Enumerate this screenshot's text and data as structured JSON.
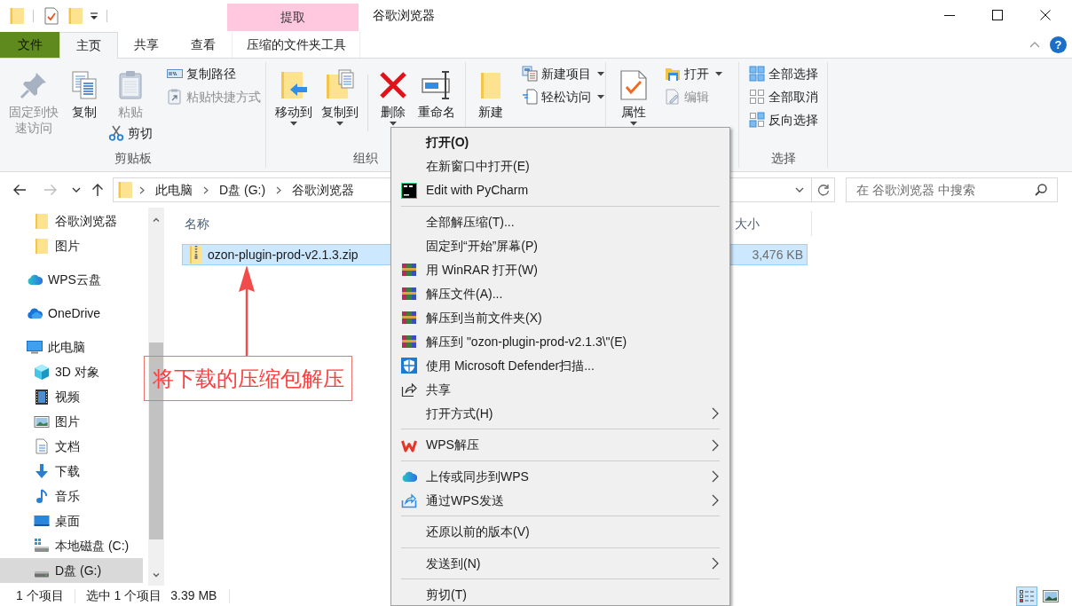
{
  "window": {
    "title": "谷歌浏览器",
    "contextual_tab_group": "提取"
  },
  "ribbon": {
    "tabs": [
      {
        "label": "文件",
        "kind": "file",
        "selected": false
      },
      {
        "label": "主页",
        "kind": "tab",
        "selected": true
      },
      {
        "label": "共享",
        "kind": "tab",
        "selected": false
      },
      {
        "label": "查看",
        "kind": "tab",
        "selected": false
      },
      {
        "label": "压缩的文件夹工具",
        "kind": "contextual",
        "selected": false
      }
    ],
    "help_button": "?",
    "groups": [
      {
        "label": "剪贴板",
        "columns": [
          {
            "buttons": [
              {
                "kind": "large",
                "label": "固定到快速访问",
                "disabled": true,
                "dropdown": false
              }
            ]
          },
          {
            "buttons": [
              {
                "kind": "large",
                "label": "复制",
                "disabled": false,
                "dropdown": false
              }
            ]
          },
          {
            "buttons": [
              {
                "kind": "large",
                "label": "粘贴",
                "disabled": true,
                "dropdown": false
              },
              {
                "kind": "small",
                "label": "剪切",
                "disabled": false,
                "dropdown": false
              }
            ]
          },
          {
            "buttons": [
              {
                "kind": "small",
                "label": "复制路径",
                "disabled": false,
                "dropdown": false
              },
              {
                "kind": "small",
                "label": "粘贴快捷方式",
                "disabled": true,
                "dropdown": false
              }
            ]
          }
        ]
      },
      {
        "label": "组织",
        "columns": [
          {
            "buttons": [
              {
                "kind": "large",
                "label": "移动到",
                "disabled": false,
                "dropdown": true
              }
            ]
          },
          {
            "buttons": [
              {
                "kind": "large",
                "label": "复制到",
                "disabled": false,
                "dropdown": true
              }
            ]
          },
          {
            "buttons": [
              {
                "kind": "large",
                "label": "删除",
                "disabled": false,
                "dropdown": true
              }
            ]
          },
          {
            "buttons": [
              {
                "kind": "large",
                "label": "重命名",
                "disabled": false,
                "dropdown": false
              }
            ]
          }
        ]
      },
      {
        "columns": [
          {
            "buttons": [
              {
                "kind": "large",
                "label": "新建",
                "disabled": false,
                "dropdown": false
              }
            ]
          },
          {
            "buttons": [
              {
                "kind": "small",
                "label": "新建项目",
                "disabled": false,
                "dropdown": true
              },
              {
                "kind": "small",
                "label": "轻松访问",
                "disabled": false,
                "dropdown": true
              }
            ]
          }
        ]
      },
      {
        "columns": [
          {
            "buttons": [
              {
                "kind": "large",
                "label": "属性",
                "disabled": false,
                "dropdown": true
              }
            ]
          },
          {
            "buttons": [
              {
                "kind": "small",
                "label": "打开",
                "disabled": false,
                "dropdown": true
              },
              {
                "kind": "small",
                "label": "编辑",
                "disabled": true,
                "dropdown": false
              }
            ]
          }
        ]
      },
      {
        "label": "选择",
        "columns": [
          {
            "buttons": [
              {
                "kind": "small",
                "label": "全部选择",
                "disabled": false,
                "dropdown": false
              },
              {
                "kind": "small",
                "label": "全部取消",
                "disabled": false,
                "dropdown": false
              },
              {
                "kind": "small",
                "label": "反向选择",
                "disabled": false,
                "dropdown": false
              }
            ]
          }
        ]
      }
    ]
  },
  "address_bar": {
    "nav_buttons": [
      {
        "kind": "back",
        "disabled": false
      },
      {
        "kind": "forward",
        "disabled": true
      },
      {
        "kind": "recent",
        "disabled": false
      },
      {
        "kind": "up",
        "disabled": false
      }
    ],
    "path": [
      "此电脑",
      "D盘 (G:)",
      "谷歌浏览器"
    ],
    "search": {
      "placeholder": "在 谷歌浏览器 中搜索"
    }
  },
  "nav_pane": {
    "tree": [
      {
        "children": [
          {
            "label": "谷歌浏览器",
            "selected": false
          },
          {
            "label": "图片",
            "selected": false
          }
        ]
      },
      {
        "label": "WPS云盘",
        "selected": false
      },
      {
        "label": "OneDrive",
        "selected": false
      },
      {
        "label": "此电脑",
        "selected": false,
        "children": [
          {
            "label": "3D 对象",
            "selected": false
          },
          {
            "label": "视频",
            "selected": false
          },
          {
            "label": "图片",
            "selected": false
          },
          {
            "label": "文档",
            "selected": false
          },
          {
            "label": "下载",
            "selected": false
          },
          {
            "label": "音乐",
            "selected": false
          },
          {
            "label": "桌面",
            "selected": false
          },
          {
            "label": "本地磁盘 (C:)",
            "selected": false
          },
          {
            "label": "D盘 (G:)",
            "selected": true
          }
        ]
      }
    ]
  },
  "file_list": {
    "columns": [
      {
        "label": "名称"
      },
      {
        "label": "大小"
      }
    ],
    "rows": [
      {
        "name": "ozon-plugin-prod-v2.1.3.zip",
        "size": "3,476 KB",
        "selected": true
      }
    ]
  },
  "annotation": {
    "text": "将下载的压缩包解压"
  },
  "context_menu": {
    "items": [
      {
        "kind": "item",
        "label": "打开(O)",
        "default": true,
        "submenu": false
      },
      {
        "kind": "item",
        "label": "在新窗口中打开(E)",
        "default": false,
        "submenu": false
      },
      {
        "kind": "item",
        "label": "Edit with PyCharm",
        "default": false,
        "submenu": false
      },
      {
        "kind": "separator"
      },
      {
        "kind": "item",
        "label": "全部解压缩(T)...",
        "default": false,
        "submenu": false
      },
      {
        "kind": "item",
        "label": "固定到“开始”屏幕(P)",
        "default": false,
        "submenu": false
      },
      {
        "kind": "item",
        "label": "用 WinRAR 打开(W)",
        "default": false,
        "submenu": false
      },
      {
        "kind": "item",
        "label": "解压文件(A)...",
        "default": false,
        "submenu": false
      },
      {
        "kind": "item",
        "label": "解压到当前文件夹(X)",
        "default": false,
        "submenu": false
      },
      {
        "kind": "item",
        "label": "解压到 \"ozon-plugin-prod-v2.1.3\\\"(E)",
        "default": false,
        "submenu": false
      },
      {
        "kind": "item",
        "label": "使用 Microsoft Defender扫描...",
        "default": false,
        "submenu": false
      },
      {
        "kind": "item",
        "label": "共享",
        "default": false,
        "submenu": false
      },
      {
        "kind": "item",
        "label": "打开方式(H)",
        "default": false,
        "submenu": true
      },
      {
        "kind": "separator"
      },
      {
        "kind": "item",
        "label": "WPS解压",
        "default": false,
        "submenu": true
      },
      {
        "kind": "separator"
      },
      {
        "kind": "item",
        "label": "上传或同步到WPS",
        "default": false,
        "submenu": true
      },
      {
        "kind": "item",
        "label": "通过WPS发送",
        "default": false,
        "submenu": true
      },
      {
        "kind": "separator"
      },
      {
        "kind": "item",
        "label": "还原以前的版本(V)",
        "default": false,
        "submenu": false
      },
      {
        "kind": "separator"
      },
      {
        "kind": "item",
        "label": "发送到(N)",
        "default": false,
        "submenu": true
      },
      {
        "kind": "separator"
      },
      {
        "kind": "item",
        "label": "剪切(T)",
        "default": false,
        "submenu": false
      }
    ]
  },
  "status_bar": {
    "item_count": "1 个项目",
    "selection": "选中 1 个项目",
    "selection_size": "3.39 MB",
    "view_buttons": [
      {
        "selected": true
      },
      {
        "selected": false
      }
    ]
  }
}
